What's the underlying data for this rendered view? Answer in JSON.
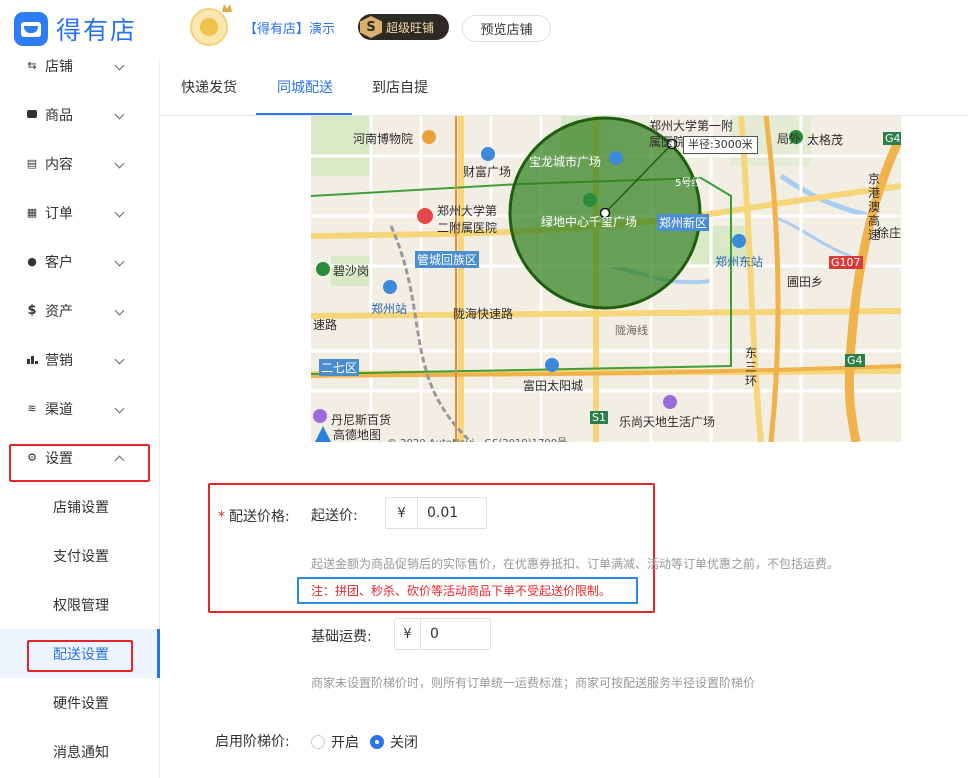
{
  "header": {
    "logo_text": "得有店",
    "shop_name": "【得有店】演示",
    "badge_letter": "S",
    "badge_text": "超级旺铺",
    "preview_label": "预览店铺"
  },
  "sidebar": {
    "items": [
      {
        "label": "店铺",
        "icon": "store-icon"
      },
      {
        "label": "商品",
        "icon": "goods-icon"
      },
      {
        "label": "内容",
        "icon": "content-icon"
      },
      {
        "label": "订单",
        "icon": "order-icon"
      },
      {
        "label": "客户",
        "icon": "customer-icon"
      },
      {
        "label": "资产",
        "icon": "dollar-icon"
      },
      {
        "label": "营销",
        "icon": "bar-chart-icon"
      },
      {
        "label": "渠道",
        "icon": "layers-icon"
      },
      {
        "label": "设置",
        "icon": "gear-icon"
      }
    ],
    "sub_items": [
      {
        "label": "店铺设置"
      },
      {
        "label": "支付设置"
      },
      {
        "label": "权限管理"
      },
      {
        "label": "配送设置"
      },
      {
        "label": "硬件设置"
      },
      {
        "label": "消息通知"
      }
    ]
  },
  "tabs": [
    {
      "label": "快递发货"
    },
    {
      "label": "同城配送"
    },
    {
      "label": "到店自提"
    }
  ],
  "map": {
    "radius_label": "半径:3000米",
    "labels": {
      "museum": "河南博物院",
      "univ1": "郑州大学第一附",
      "univ1b": "属医院",
      "caifu": "财富广场",
      "baolong": "宝龙城市广场",
      "univ2": "郑州大学第",
      "univ2b": "二附属医院",
      "greenland": "绿地中心千玺广场",
      "bishagang": "碧沙岗",
      "zz_station": "郑州站",
      "longhai": "陇海快速路",
      "sudu": "速路",
      "fuxin": "富田太阳城",
      "danis": "丹尼斯百货",
      "gaode": "高德地图",
      "leshang": "乐尚天地生活广场",
      "east_station": "郑州东站",
      "putian": "圃田乡",
      "taigecheng": "太格茂",
      "juwai": "局外",
      "xujia": "徐庄",
      "jinggang": "京港澳高速",
      "dongsan": "东三环",
      "longhai_line": "陇海线",
      "line5": "5号线"
    },
    "blue_labels": {
      "guancheng": "管城回族区",
      "zhengdong": "郑州新区",
      "erqi": "二七区"
    },
    "road_tags": {
      "g4_top": "G4",
      "g107": "G107",
      "g4_bottom": "G4",
      "s1": "S1"
    },
    "copyright": "© 2020 AutoNavi - GS(2019)1700号"
  },
  "form": {
    "price_label": "配送价格:",
    "start_label": "起送价:",
    "currency": "¥",
    "start_value": "0.01",
    "start_hint": "起送金额为商品促销后的实际售价，在优惠券抵扣、订单满减、活动等订单优惠之前，不包括运费。",
    "note": "注：拼团、秒杀、砍价等活动商品下单不受起送价限制。",
    "base_label": "基础运费:",
    "base_value": "0",
    "base_hint": "商家未设置阶梯价时，则所有订单统一运费标准；商家可按配送服务半径设置阶梯价",
    "tier_label": "启用阶梯价:",
    "tier_options": [
      {
        "label": "开启",
        "checked": false
      },
      {
        "label": "关闭",
        "checked": true
      }
    ]
  }
}
